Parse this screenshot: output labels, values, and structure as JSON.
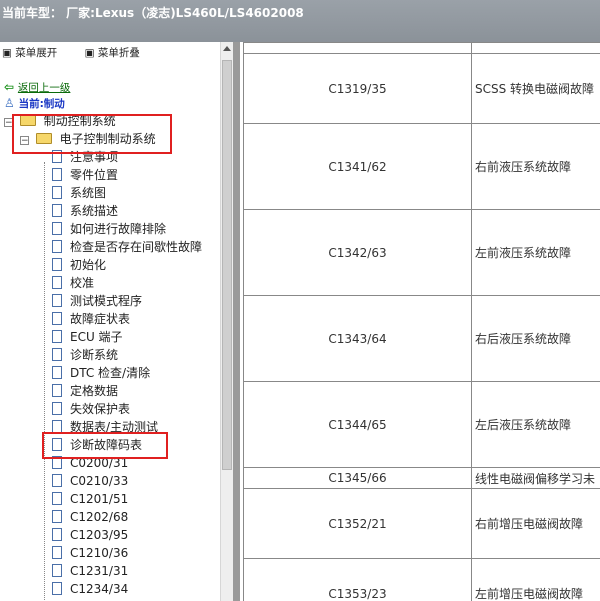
{
  "header": {
    "title": "当前车型：  厂家:Lexus（凌志)LS460L/LS4602008"
  },
  "menubar": {
    "expand_label": "菜单展开",
    "collapse_label": "菜单折叠"
  },
  "nav": {
    "back_label": "返回上一级",
    "current_label": "当前:制动"
  },
  "tree": {
    "brake_system": "制动控制系统",
    "electronic_brake": "电子控制制动系统",
    "items": [
      "注意事项",
      "零件位置",
      "系统图",
      "系统描述",
      "如何进行故障排除",
      "检查是否存在间歇性故障",
      "初始化",
      "校准",
      "测试模式程序",
      "故障症状表",
      "ECU 端子",
      "诊断系统",
      "DTC 检查/清除",
      "定格数据",
      "失效保护表",
      "数据表/主动测试",
      "诊断故障码表",
      "C0200/31",
      "C0210/33",
      "C1201/51",
      "C1202/68",
      "C1203/95",
      "C1210/36",
      "C1231/31",
      "C1234/34"
    ]
  },
  "table": {
    "rows": [
      {
        "code": "",
        "desc": ""
      },
      {
        "code": "C1319/35",
        "desc": "SCSS 转换电磁阀故障"
      },
      {
        "code": "C1341/62",
        "desc": "右前液压系统故障"
      },
      {
        "code": "C1342/63",
        "desc": "左前液压系统故障"
      },
      {
        "code": "C1343/64",
        "desc": "右后液压系统故障"
      },
      {
        "code": "C1344/65",
        "desc": "左后液压系统故障"
      },
      {
        "code": "C1345/66",
        "desc": "线性电磁阀偏移学习未"
      },
      {
        "code": "C1352/21",
        "desc": "右前增压电磁阀故障"
      },
      {
        "code": "C1353/23",
        "desc": "左前增压电磁阀故障"
      }
    ]
  },
  "colors": {
    "header_bg": "#9aa1a8",
    "highlight_border": "#e02020",
    "back_link": "#0a6a0a",
    "current": "#1a37c4"
  }
}
